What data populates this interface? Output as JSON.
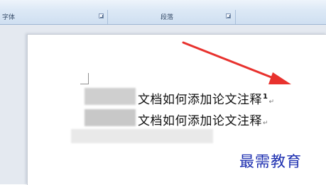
{
  "ribbon": {
    "groups": [
      {
        "label": "字体"
      },
      {
        "label": "段落"
      }
    ]
  },
  "document": {
    "lines": [
      {
        "text": "文档如何添加论文注释",
        "footnote_ref": "1",
        "para_mark": "↵"
      },
      {
        "text": "文档如何添加论文注释",
        "para_mark": "↵"
      }
    ]
  },
  "annotation": {
    "arrow_color": "#e8322e"
  },
  "watermark": {
    "text": "最需教育"
  },
  "colors": {
    "ribbon": "#dde9f6",
    "watermark": "#1d2fb0",
    "arrow": "#e8322e"
  }
}
